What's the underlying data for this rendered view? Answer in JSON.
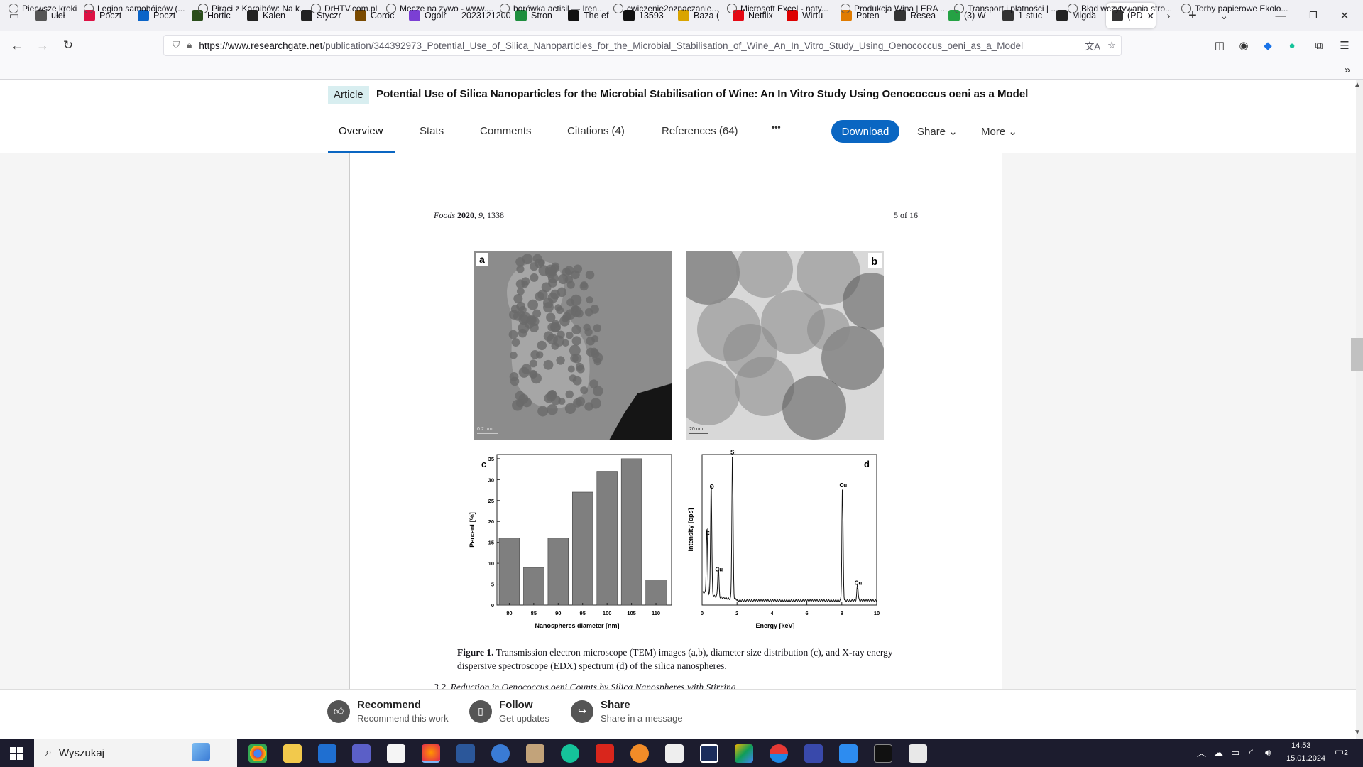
{
  "browser": {
    "tabs": [
      {
        "label": "ułeł",
        "icon": "chevron-left-icon",
        "color": "#555"
      },
      {
        "label": "Poczt",
        "icon": "mail-icon",
        "color": "#d14"
      },
      {
        "label": "Poczt",
        "icon": "outlook-icon",
        "color": "#0a64c8"
      },
      {
        "label": "Hortic",
        "icon": "horticulture-icon",
        "color": "#2a4d1a"
      },
      {
        "label": "Kalen",
        "icon": "wine-glass-icon",
        "color": "#222"
      },
      {
        "label": "Styczr",
        "icon": "wine-glass-icon",
        "color": "#222"
      },
      {
        "label": "Coroc",
        "icon": "bottle-icon",
        "color": "#7a4a00"
      },
      {
        "label": "Ogólr",
        "icon": "list-icon",
        "color": "#7b3fd4"
      },
      {
        "label": "2023121200",
        "icon": "",
        "color": ""
      },
      {
        "label": "Stron",
        "icon": "drive-icon",
        "color": "#1e8e3e"
      },
      {
        "label": "The ef",
        "icon": "sn-icon",
        "color": "#111"
      },
      {
        "label": "13593",
        "icon": "sn-icon",
        "color": "#111"
      },
      {
        "label": "Baza (",
        "icon": "bulb-icon",
        "color": "#d9a400"
      },
      {
        "label": "Netflix",
        "icon": "netflix-icon",
        "color": "#e50914"
      },
      {
        "label": "Wirtu",
        "icon": "wp-icon",
        "color": "#d00"
      },
      {
        "label": "Poten",
        "icon": "e-icon",
        "color": "#e07b00"
      },
      {
        "label": "Resea",
        "icon": "researchgate-icon",
        "color": "#333"
      },
      {
        "label": "(3) W",
        "icon": "whatsapp-icon",
        "color": "#25a244"
      },
      {
        "label": "1-stuc",
        "icon": "researchgate-icon",
        "color": "#333"
      },
      {
        "label": "Migda",
        "icon": "wikipedia-icon",
        "color": "#222"
      },
      {
        "label": "(PD",
        "icon": "researchgate-icon",
        "color": "#333"
      }
    ],
    "url_host": "https://www.researchgate.net",
    "url_path": "/publication/344392973_Potential_Use_of_Silica_Nanoparticles_for_the_Microbial_Stabilisation_of_Wine_An_In_Vitro_Study_Using_Oenococcus_oeni_as_a_Model",
    "bookmarks": [
      "Pierwsze kroki",
      "Legion samobójców (...",
      "Piraci z Karaibów: Na k...",
      "DrHTV.com.pl",
      "Mecze na zywo - www....",
      "borówka actisil — Iren...",
      "cwiczenie2oznaczanie...",
      "Microsoft Excel - naty...",
      "Produkcja Wina | ERA ...",
      "Transport i płatności | ...",
      "Błąd wczytywania stro...",
      "Torby papierowe Ekolo..."
    ]
  },
  "article": {
    "badge": "Article",
    "title": "Potential Use of Silica Nanoparticles for the Microbial Stabilisation of Wine: An In Vitro Study Using Oenococcus oeni as a Model",
    "tabs": [
      "Overview",
      "Stats",
      "Comments",
      "Citations (4)",
      "References (64)",
      "•••"
    ],
    "download": "Download",
    "share": "Share",
    "more": "More"
  },
  "pdf": {
    "journal": "Foods",
    "year": "2020",
    "volume": "9",
    "pages": "1338",
    "page_of": "5 of 16",
    "panel_a": "a",
    "panel_b": "b",
    "panel_c": "c",
    "panel_d": "d",
    "scale_a": "0.2 µm",
    "scale_b": "20 nm",
    "caption_label": "Figure 1.",
    "caption_text": "Transmission electron microscope (TEM) images (a,b), diameter size distribution (c), and X-ray energy dispersive spectroscope (EDX) spectrum (d) of the silica nanospheres.",
    "section": "3.2. Reduction in Oenococcus oeni Counts by Silica Nanospheres with Stirring"
  },
  "chart_data": [
    {
      "type": "bar",
      "panel": "c",
      "categories": [
        "80",
        "85",
        "90",
        "95",
        "100",
        "105",
        "110"
      ],
      "values": [
        16,
        9,
        16,
        27,
        32,
        35,
        6
      ],
      "xlabel": "Nanospheres diameter [nm]",
      "ylabel": "Percent [%]",
      "ylim": [
        0,
        36
      ],
      "yticks": [
        "0",
        "5",
        "10",
        "15",
        "20",
        "25",
        "30",
        "35"
      ]
    },
    {
      "type": "line",
      "panel": "d",
      "xlabel": "Energy [keV]",
      "ylabel": "Intensity [cps]",
      "xlim": [
        0,
        10
      ],
      "xticks": [
        "0",
        "2",
        "4",
        "6",
        "8",
        "10"
      ],
      "ylim": [
        0,
        100
      ],
      "peaks": [
        {
          "label": "C",
          "x": 0.28,
          "y": 44
        },
        {
          "label": "O",
          "x": 0.52,
          "y": 75
        },
        {
          "label": "Cu",
          "x": 0.93,
          "y": 20
        },
        {
          "label": "Si",
          "x": 1.74,
          "y": 98
        },
        {
          "label": "Cu",
          "x": 8.04,
          "y": 76
        },
        {
          "label": "Cu",
          "x": 8.9,
          "y": 11
        }
      ]
    }
  ],
  "footer": {
    "recommend": "Recommend",
    "recommend_sub": "Recommend this work",
    "follow": "Follow",
    "follow_sub": "Get updates",
    "share": "Share",
    "share_sub": "Share in a message"
  },
  "taskbar": {
    "search": "Wyszukaj",
    "time": "14:53",
    "date": "15.01.2024",
    "notif": "2"
  }
}
